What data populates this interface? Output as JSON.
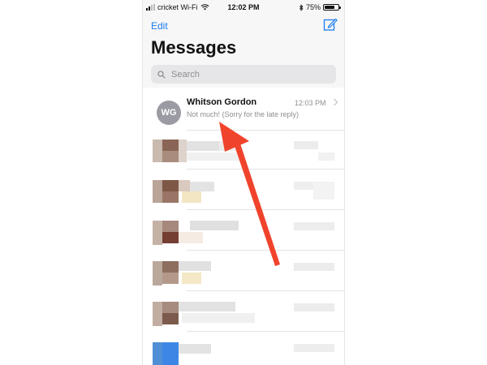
{
  "status_bar": {
    "carrier": "cricket Wi-Fi",
    "time": "12:02 PM",
    "battery": "75%",
    "battery_level": 0.75
  },
  "header": {
    "edit_label": "Edit",
    "title": "Messages"
  },
  "search": {
    "placeholder": "Search"
  },
  "conversations": [
    {
      "initials": "WG",
      "name": "Whitson Gordon",
      "time": "12:03 PM",
      "preview": "Not much! (Sorry for the late reply)"
    }
  ],
  "colors": {
    "accent": "#1a7cf0",
    "avatar": "#9b9ba3",
    "annotation_arrow": "#f0432c"
  },
  "icons": {
    "compose": "compose-icon",
    "search": "search-icon",
    "chevron": "chevron-right-icon"
  }
}
